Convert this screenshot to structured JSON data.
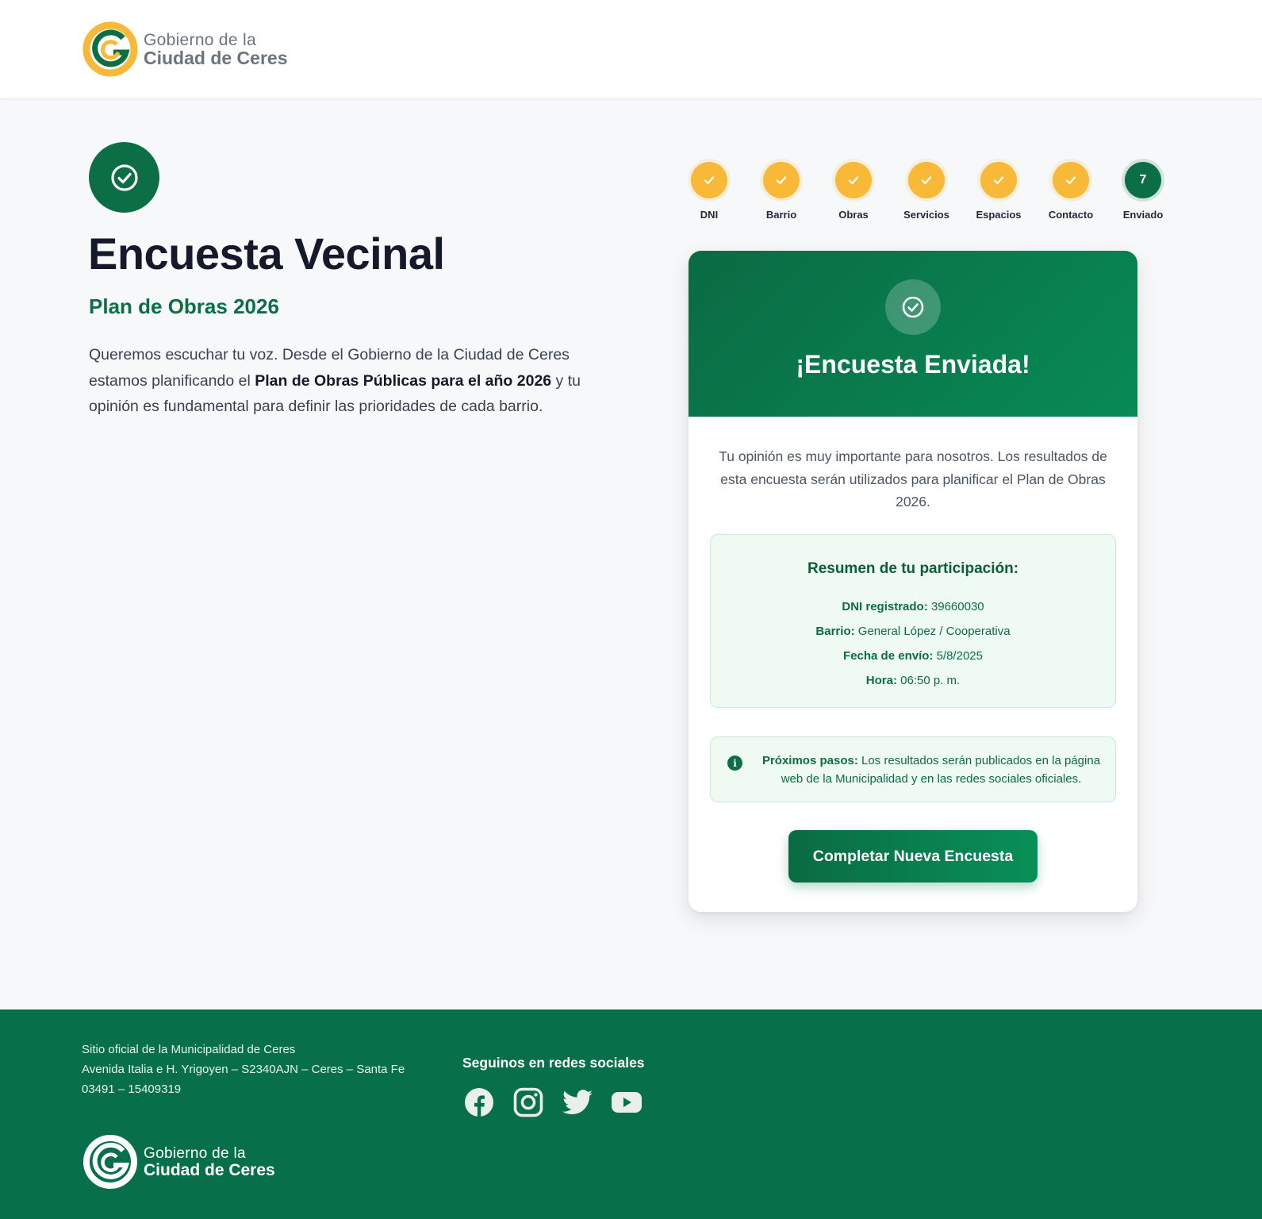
{
  "header": {
    "logo": {
      "line1": "Gobierno de la",
      "line2": "Ciudad de Ceres"
    }
  },
  "hero": {
    "title": "Encuesta Vecinal",
    "subtitle": "Plan de Obras 2026",
    "desc_part1": "Queremos escuchar tu voz. Desde el Gobierno de la Ciudad de Ceres estamos planificando el ",
    "desc_bold": "Plan de Obras Públicas para el año 2026",
    "desc_part2": " y tu opinión es fundamental para definir las prioridades de cada barrio."
  },
  "stepper": {
    "steps": [
      {
        "label": "DNI",
        "status": "done"
      },
      {
        "label": "Barrio",
        "status": "done"
      },
      {
        "label": "Obras",
        "status": "done"
      },
      {
        "label": "Servicios",
        "status": "done"
      },
      {
        "label": "Espacios",
        "status": "done"
      },
      {
        "label": "Contacto",
        "status": "done"
      },
      {
        "label": "Enviado",
        "status": "current",
        "number": "7"
      }
    ]
  },
  "card": {
    "title": "¡Encuesta Enviada!",
    "message": "Tu opinión es muy importante para nosotros. Los resultados de esta encuesta serán utilizados para planificar el Plan de Obras 2026.",
    "summary": {
      "title": "Resumen de tu participación:",
      "dni_label": "DNI registrado:",
      "dni_value": "39660030",
      "barrio_label": "Barrio:",
      "barrio_value": "General López / Cooperativa",
      "fecha_label": "Fecha de envío:",
      "fecha_value": "5/8/2025",
      "hora_label": "Hora:",
      "hora_value": "06:50 p. m."
    },
    "next_steps": {
      "label": "Próximos pasos:",
      "text": "Los resultados serán publicados en la página web de la Municipalidad y en las redes sociales oficiales."
    },
    "button_label": "Completar Nueva Encuesta"
  },
  "footer": {
    "line1": "Sitio oficial de la Municipalidad de Ceres",
    "line2": "Avenida Italia e H. Yrigoyen – S2340AJN – Ceres – Santa Fe",
    "line3": "03491 – 15409319",
    "social_title": "Seguinos en redes sociales",
    "social_icons": [
      "facebook-icon",
      "instagram-icon",
      "twitter-icon",
      "youtube-icon"
    ],
    "logo": {
      "line1": "Gobierno de la",
      "line2": "Ciudad de Ceres"
    }
  },
  "colors": {
    "brand_green": "#0b6e45",
    "accent_yellow": "#f8b838",
    "footer_green": "#07704a"
  }
}
